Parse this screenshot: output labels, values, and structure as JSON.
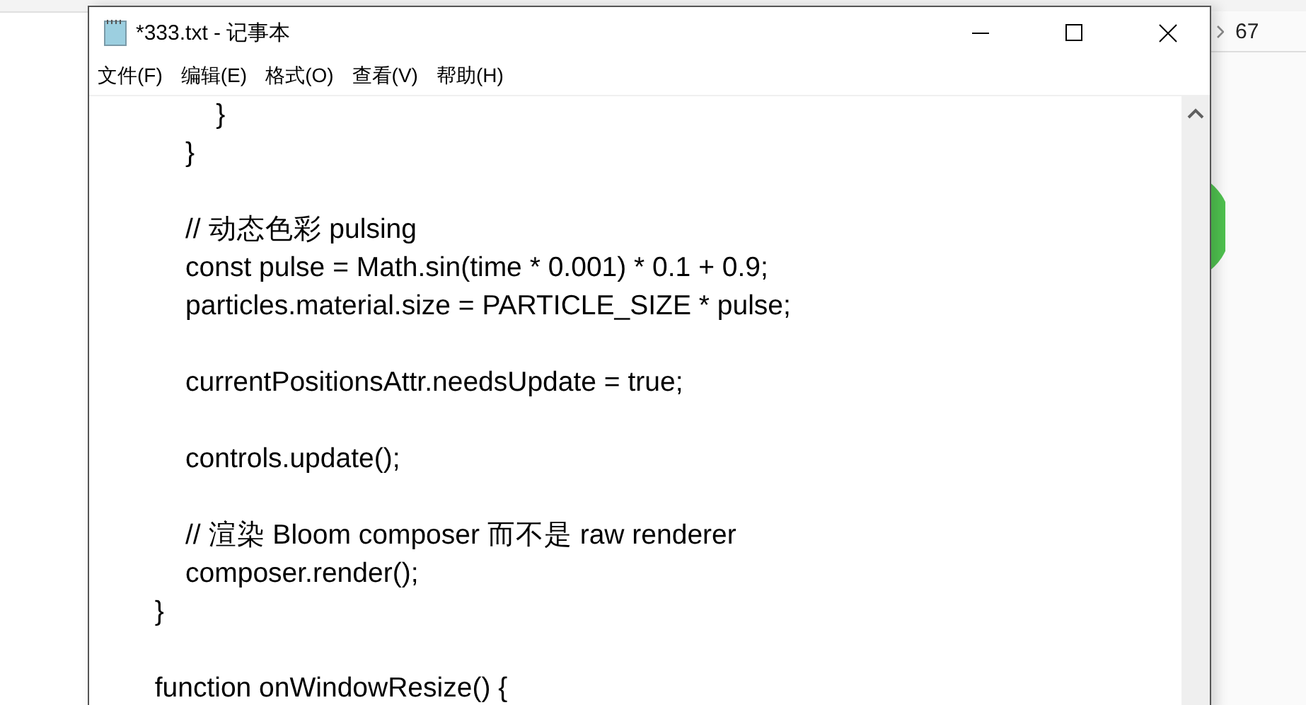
{
  "background": {
    "breadcrumb": "67"
  },
  "window": {
    "title": "*333.txt - 记事本"
  },
  "menu": [
    "文件(F)",
    "编辑(E)",
    "格式(O)",
    "查看(V)",
    "帮助(H)"
  ],
  "editor": {
    "blocks": [
      [
        "                }",
        "            }"
      ],
      [
        "            // 动态色彩 pulsing",
        "            const pulse = Math.sin(time * 0.001) * 0.1 + 0.9;",
        "            particles.material.size = PARTICLE_SIZE * pulse;"
      ],
      [
        "            currentPositionsAttr.needsUpdate = true;"
      ],
      [
        "            controls.update();"
      ],
      [
        "            // 渲染 Bloom composer 而不是 raw renderer",
        "            composer.render();",
        "        }"
      ],
      [
        "        function onWindowResize() {"
      ]
    ]
  }
}
